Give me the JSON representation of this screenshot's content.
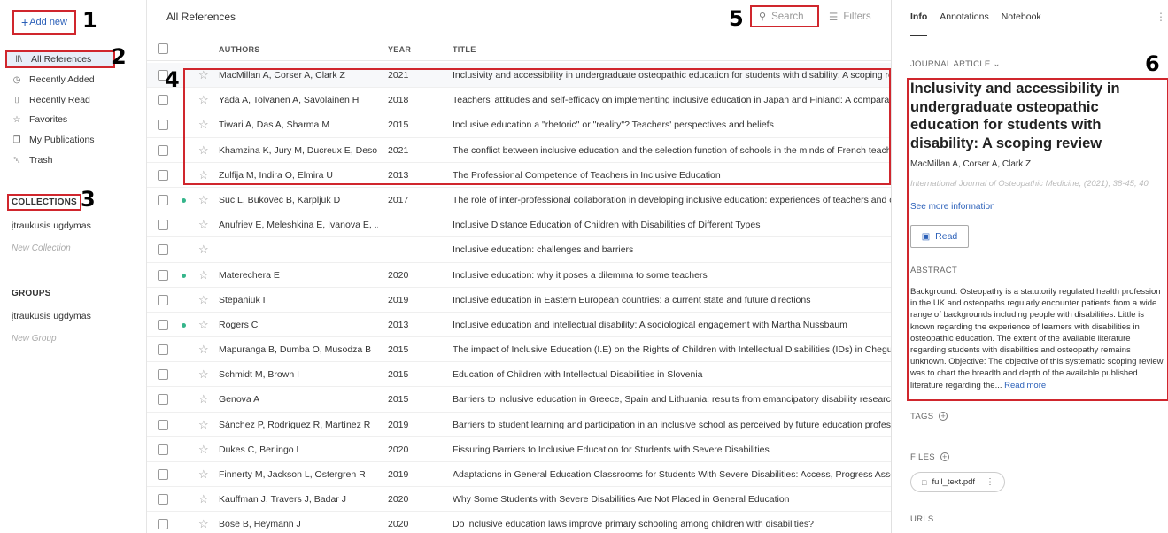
{
  "sidebar": {
    "add_new": "Add new",
    "nav": [
      {
        "label": "All References",
        "icon": "library-icon"
      },
      {
        "label": "Recently Added",
        "icon": "clock-icon"
      },
      {
        "label": "Recently Read",
        "icon": "bookmark-icon"
      },
      {
        "label": "Favorites",
        "icon": "star-icon"
      },
      {
        "label": "My Publications",
        "icon": "document-icon"
      },
      {
        "label": "Trash",
        "icon": "trash-icon"
      }
    ],
    "collections_label": "COLLECTIONS",
    "collection_item": "įtraukusis ugdymas",
    "new_collection": "New Collection",
    "groups_label": "GROUPS",
    "group_item": "įtraukusis ugdymas",
    "new_group": "New Group"
  },
  "annotations": {
    "n1": "1",
    "n2": "2",
    "n3": "3",
    "n4": "4",
    "n5": "5",
    "n6": "6"
  },
  "main": {
    "title": "All References",
    "search_placeholder": "Search",
    "filters": "Filters",
    "columns": {
      "authors": "AUTHORS",
      "year": "YEAR",
      "title": "TITLE"
    },
    "rows": [
      {
        "authors": "MacMillan A, Corser A, Clark Z",
        "year": "2021",
        "title": "Inclusivity and accessibility in undergraduate osteopathic education for students with disability: A scoping review",
        "dot": false
      },
      {
        "authors": "Yada A, Tolvanen A, Savolainen H",
        "year": "2018",
        "title": "Teachers' attitudes and self-efficacy on implementing inclusive education in Japan and Finland: A comparative study",
        "dot": false
      },
      {
        "authors": "Tiwari A, Das A, Sharma M",
        "year": "2015",
        "title": "Inclusive education a \"rhetoric\" or \"reality\"? Teachers' perspectives and beliefs",
        "dot": false
      },
      {
        "authors": "Khamzina K, Jury M, Ducreux E, Deso...",
        "year": "2021",
        "title": "The conflict between inclusive education and the selection function of schools in the minds of French teachers",
        "dot": false
      },
      {
        "authors": "Zulfija M, Indira O, Elmira U",
        "year": "2013",
        "title": "The Professional Competence of Teachers in Inclusive Education",
        "dot": false
      },
      {
        "authors": "Suc L, Bukovec B, Karpljuk D",
        "year": "2017",
        "title": "The role of inter-professional collaboration in developing inclusive education: experiences of teachers and occupational therapists",
        "dot": true
      },
      {
        "authors": "Anufriev E, Meleshkina E, Ivanova E, ...",
        "year": "",
        "title": "Inclusive Distance Education of Children with Disabilities of Different Types",
        "dot": false
      },
      {
        "authors": "",
        "year": "",
        "title": "Inclusive education: challenges and barriers",
        "dot": false
      },
      {
        "authors": "Materechera E",
        "year": "2020",
        "title": "Inclusive education: why it poses a dilemma to some teachers",
        "dot": true
      },
      {
        "authors": "Stepaniuk I",
        "year": "2019",
        "title": "Inclusive education in Eastern European countries: a current state and future directions",
        "dot": false
      },
      {
        "authors": "Rogers C",
        "year": "2013",
        "title": "Inclusive education and intellectual disability: A sociological engagement with Martha Nussbaum",
        "dot": true
      },
      {
        "authors": "Mapuranga B, Dumba O, Musodza B",
        "year": "2015",
        "title": "The impact of Inclusive Education (I.E) on the Rights of Children with Intellectual Disabilities (IDs) in Chegutu",
        "dot": false
      },
      {
        "authors": "Schmidt M, Brown I",
        "year": "2015",
        "title": "Education of Children with Intellectual Disabilities in Slovenia",
        "dot": false
      },
      {
        "authors": "Genova A",
        "year": "2015",
        "title": "Barriers to inclusive education in Greece, Spain and Lithuania: results from emancipatory disability research",
        "dot": false
      },
      {
        "authors": "Sánchez P, Rodríguez R, Martínez R",
        "year": "2019",
        "title": "Barriers to student learning and participation in an inclusive school as perceived by future education professionals",
        "dot": false
      },
      {
        "authors": "Dukes C, Berlingo L",
        "year": "2020",
        "title": "Fissuring Barriers to Inclusive Education for Students with Severe Disabilities",
        "dot": false
      },
      {
        "authors": "Finnerty M, Jackson L, Ostergren R",
        "year": "2019",
        "title": "Adaptations in General Education Classrooms for Students With Severe Disabilities: Access, Progress Assessment",
        "dot": false
      },
      {
        "authors": "Kauffman J, Travers J, Badar J",
        "year": "2020",
        "title": "Why Some Students with Severe Disabilities Are Not Placed in General Education",
        "dot": false
      },
      {
        "authors": "Bose B, Heymann J",
        "year": "2020",
        "title": "Do inclusive education laws improve primary schooling among children with disabilities?",
        "dot": false
      }
    ]
  },
  "panel": {
    "tabs": [
      "Info",
      "Annotations",
      "Notebook"
    ],
    "type_label": "JOURNAL ARTICLE",
    "title": "Inclusivity and accessibility in undergraduate osteopathic education for students with disability: A scoping review",
    "authors": "MacMillan A, Corser A, Clark Z",
    "journal": "International Journal of Osteopathic Medicine, (2021), 38-45, 40",
    "see_more": "See more information",
    "read": "Read",
    "abstract_label": "ABSTRACT",
    "abstract": "Background: Osteopathy is a statutorily regulated health profession in the UK and osteopaths regularly encounter patients from a wide range of backgrounds including people with disabilities. Little is known regarding the experience of learners with disabilities in osteopathic education. The extent of the available literature regarding students with disabilities and osteopathy remains unknown. Objective: The objective of this systematic scoping review was to chart the breadth and depth of the available published literature regarding the... ",
    "read_more": "Read more",
    "tags_label": "TAGS",
    "files_label": "FILES",
    "file_name": "full_text.pdf",
    "urls_label": "URLS"
  },
  "colors": {
    "accent": "#2a5fb8",
    "highlight": "#d0262d",
    "dot": "#35b58b"
  }
}
